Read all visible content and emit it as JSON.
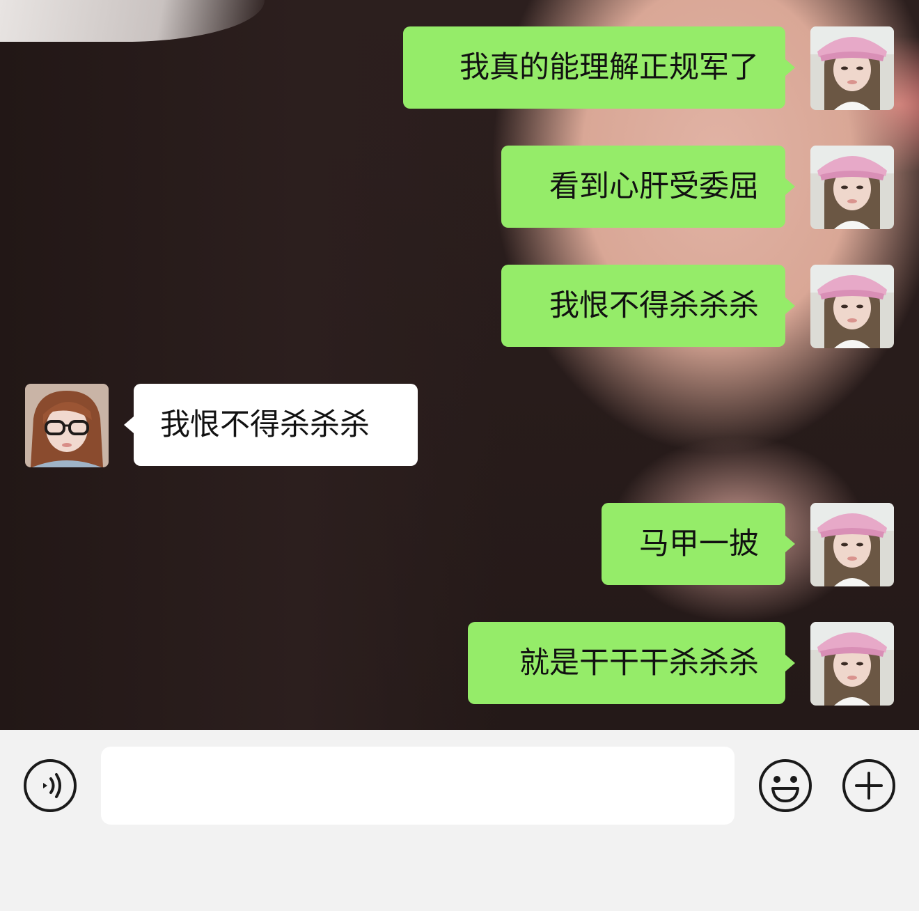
{
  "conversation": {
    "messages": [
      {
        "direction": "outgoing",
        "text": "我真的能理解正规军了"
      },
      {
        "direction": "outgoing",
        "text": "看到心肝受委屈"
      },
      {
        "direction": "outgoing",
        "text": "我恨不得杀杀杀"
      },
      {
        "direction": "incoming",
        "text": "我恨不得杀杀杀"
      },
      {
        "direction": "outgoing",
        "text": "马甲一披"
      },
      {
        "direction": "outgoing",
        "text": "就是干干干杀杀杀"
      }
    ]
  },
  "input_bar": {
    "voice_icon": "voice-icon",
    "emoji_icon": "emoji-icon",
    "plus_icon": "plus-icon",
    "text_value": ""
  },
  "colors": {
    "outgoing_bubble": "#95ec69",
    "incoming_bubble": "#ffffff",
    "input_bar_bg": "#f2f2f2"
  }
}
